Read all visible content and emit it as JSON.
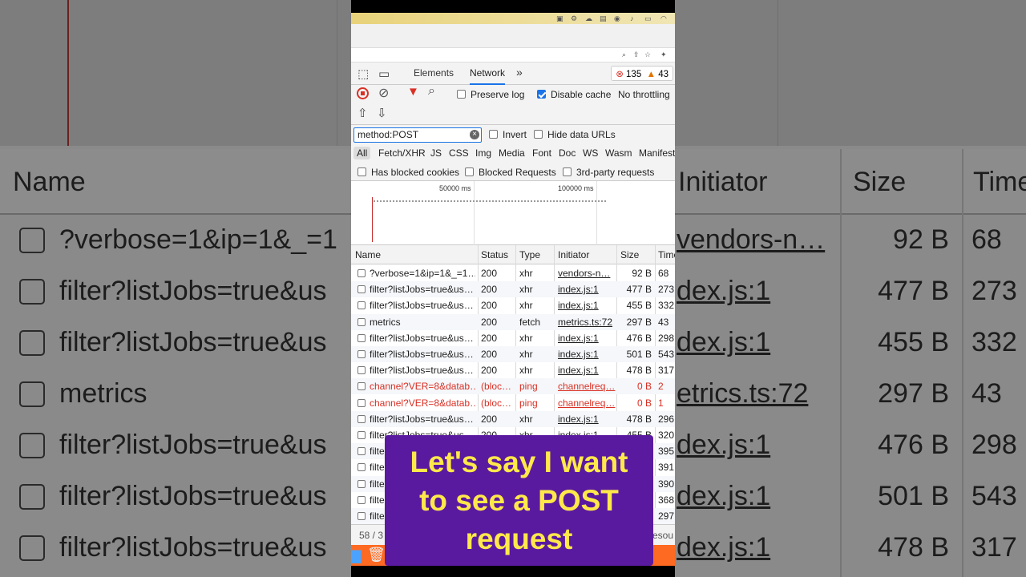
{
  "background": {
    "headers": {
      "name": "Name",
      "initiator": "Initiator",
      "size": "Size",
      "time": "Time"
    },
    "rows": [
      {
        "name": "?verbose=1&ip=1&_=1",
        "initiator": "vendors-n…",
        "size": "92 B",
        "time": "68"
      },
      {
        "name": "filter?listJobs=true&us",
        "initiator": "dex.js:1",
        "size": "477 B",
        "time": "273"
      },
      {
        "name": "filter?listJobs=true&us",
        "initiator": "dex.js:1",
        "size": "455 B",
        "time": "332"
      },
      {
        "name": "metrics",
        "initiator": "etrics.ts:72",
        "size": "297 B",
        "time": "43"
      },
      {
        "name": "filter?listJobs=true&us",
        "initiator": "dex.js:1",
        "size": "476 B",
        "time": "298"
      },
      {
        "name": "filter?listJobs=true&us",
        "initiator": "dex.js:1",
        "size": "501 B",
        "time": "543"
      },
      {
        "name": "filter?listJobs=true&us",
        "initiator": "dex.js:1",
        "size": "478 B",
        "time": "317"
      }
    ]
  },
  "devtools": {
    "tabs": {
      "elements": "Elements",
      "network": "Network",
      "more": "»"
    },
    "errors": "135",
    "warnings": "43",
    "toolbar": {
      "preserve_log": "Preserve log",
      "disable_cache": "Disable cache",
      "throttling": "No throttling"
    },
    "filter": {
      "value": "method:POST",
      "invert": "Invert",
      "hide_data_urls": "Hide data URLs"
    },
    "types": [
      "All",
      "Fetch/XHR",
      "JS",
      "CSS",
      "Img",
      "Media",
      "Font",
      "Doc",
      "WS",
      "Wasm",
      "Manifest"
    ],
    "options": {
      "blocked_cookies": "Has blocked cookies",
      "blocked_requests": "Blocked Requests",
      "third_party": "3rd-party requests"
    },
    "timeline": {
      "tick1": "50000 ms",
      "tick2": "100000 ms"
    },
    "columns": {
      "name": "Name",
      "status": "Status",
      "type": "Type",
      "initiator": "Initiator",
      "size": "Size",
      "time": "Time"
    },
    "rows": [
      {
        "name": "?verbose=1&ip=1&_=1…",
        "status": "200",
        "type": "xhr",
        "initiator": "vendors-n…",
        "size": "92 B",
        "time": "68"
      },
      {
        "name": "filter?listJobs=true&us…",
        "status": "200",
        "type": "xhr",
        "initiator": "index.js:1",
        "size": "477 B",
        "time": "273"
      },
      {
        "name": "filter?listJobs=true&us…",
        "status": "200",
        "type": "xhr",
        "initiator": "index.js:1",
        "size": "455 B",
        "time": "332"
      },
      {
        "name": "metrics",
        "status": "200",
        "type": "fetch",
        "initiator": "metrics.ts:72",
        "size": "297 B",
        "time": "43"
      },
      {
        "name": "filter?listJobs=true&us…",
        "status": "200",
        "type": "xhr",
        "initiator": "index.js:1",
        "size": "476 B",
        "time": "298"
      },
      {
        "name": "filter?listJobs=true&us…",
        "status": "200",
        "type": "xhr",
        "initiator": "index.js:1",
        "size": "501 B",
        "time": "543"
      },
      {
        "name": "filter?listJobs=true&us…",
        "status": "200",
        "type": "xhr",
        "initiator": "index.js:1",
        "size": "478 B",
        "time": "317"
      },
      {
        "name": "channel?VER=8&datab…",
        "status": "(bloc…",
        "type": "ping",
        "initiator": "channelreq…",
        "size": "0 B",
        "time": "2"
      },
      {
        "name": "channel?VER=8&datab…",
        "status": "(bloc…",
        "type": "ping",
        "initiator": "channelreq…",
        "size": "0 B",
        "time": "1"
      },
      {
        "name": "filter?listJobs=true&us…",
        "status": "200",
        "type": "xhr",
        "initiator": "index.js:1",
        "size": "478 B",
        "time": "296"
      },
      {
        "name": "filter?listJobs=true&us…",
        "status": "200",
        "type": "xhr",
        "initiator": "index.js:1",
        "size": "455 B",
        "time": "320"
      },
      {
        "name": "filte",
        "status": "",
        "type": "",
        "initiator": "",
        "size": "",
        "time": "395"
      },
      {
        "name": "filte",
        "status": "",
        "type": "",
        "initiator": "",
        "size": "",
        "time": "391"
      },
      {
        "name": "filte",
        "status": "",
        "type": "",
        "initiator": "",
        "size": "",
        "time": "390"
      },
      {
        "name": "filte",
        "status": "",
        "type": "",
        "initiator": "",
        "size": "",
        "time": "368"
      },
      {
        "name": "filte",
        "status": "",
        "type": "",
        "initiator": "",
        "size": "",
        "time": "297"
      }
    ],
    "footer": {
      "requests": "58 / 3",
      "resources": "resou"
    }
  },
  "caption": {
    "line1": "Let's say I want",
    "line2": "to see a POST",
    "line3": "request"
  },
  "colors": {
    "accent": "#1a73e8",
    "error": "#d93025",
    "caption_bg": "#5a1aa0",
    "caption_text": "#ffe84a"
  }
}
